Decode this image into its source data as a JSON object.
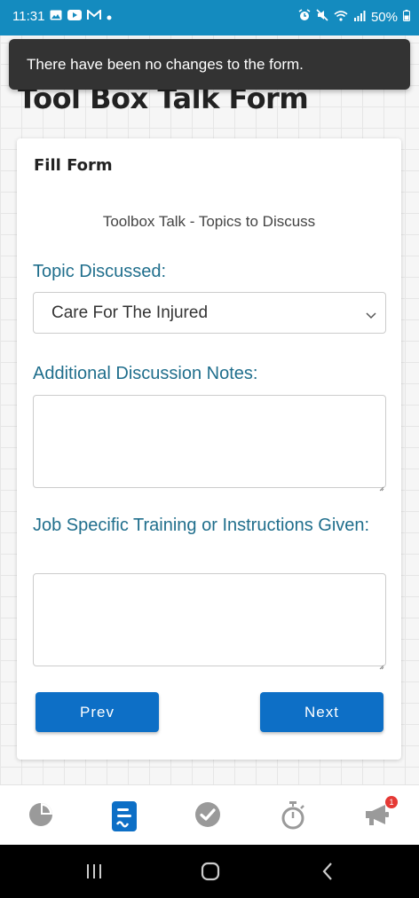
{
  "status_bar": {
    "time": "11:31",
    "battery": "50%",
    "notification_icons": [
      "image-icon",
      "youtube-icon",
      "gmail-icon",
      "dot-icon"
    ],
    "system_icons": [
      "alarm-icon",
      "mute-icon",
      "wifi-icon",
      "signal-icon",
      "battery-icon"
    ]
  },
  "toast": {
    "message": "There have been no changes to the form."
  },
  "page": {
    "title": "Tool Box Talk Form"
  },
  "form": {
    "card_title": "Fill Form",
    "section_subtitle": "Toolbox Talk - Topics to Discuss",
    "topic": {
      "label": "Topic Discussed:",
      "selected": "Care For The Injured"
    },
    "notes": {
      "label": "Additional Discussion Notes:",
      "value": ""
    },
    "training": {
      "label": "Job Specific Training or Instructions Given:",
      "value": ""
    },
    "prev_label": "Prev",
    "next_label": "Next"
  },
  "bottom_nav": {
    "items": [
      {
        "icon": "pie-chart-icon",
        "active": false
      },
      {
        "icon": "form-document-icon",
        "active": true
      },
      {
        "icon": "check-circle-icon",
        "active": false
      },
      {
        "icon": "stopwatch-icon",
        "active": false
      },
      {
        "icon": "megaphone-icon",
        "active": false,
        "badge": "1"
      }
    ]
  },
  "colors": {
    "status_bar": "#148bbf",
    "accent": "#0d6fc6",
    "label": "#1f6e8c",
    "badge": "#e53935"
  }
}
